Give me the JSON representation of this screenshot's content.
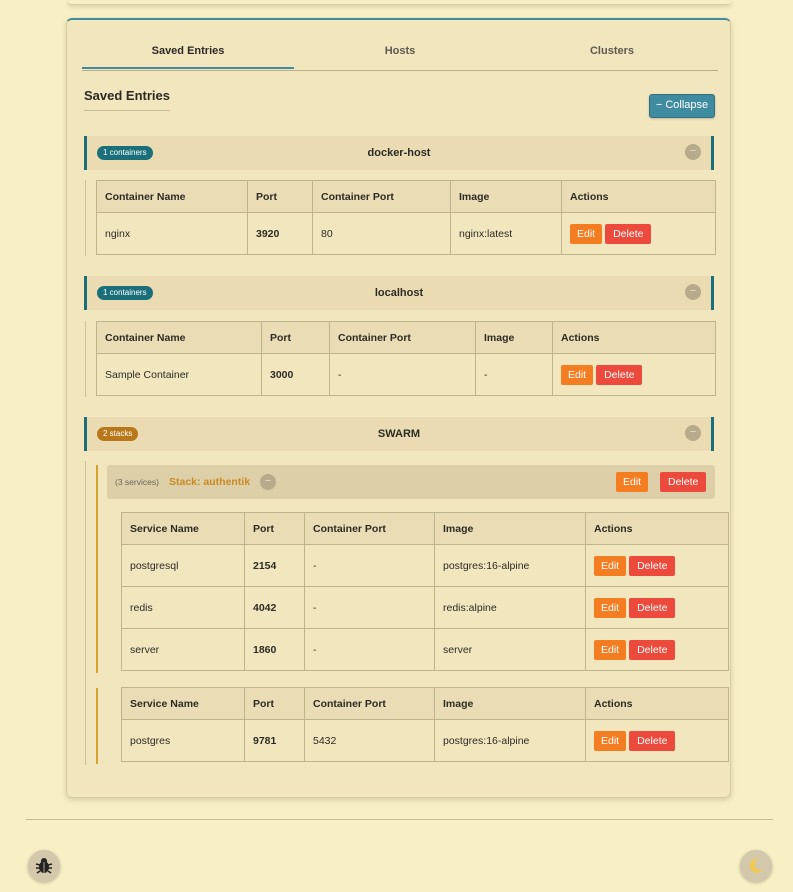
{
  "tabs": [
    "Saved Entries",
    "Hosts",
    "Clusters"
  ],
  "section_title": "Saved Entries",
  "collapse_label": "− Collapse",
  "toggle_symbol": "−",
  "hosts": [
    {
      "badge": "1 containers",
      "name": "docker-host",
      "headers": [
        "Container Name",
        "Port",
        "Container Port",
        "Image",
        "Actions"
      ],
      "rows": [
        [
          "nginx",
          "3920",
          "80",
          "nginx:latest"
        ]
      ]
    },
    {
      "badge": "1 containers",
      "name": "localhost",
      "headers": [
        "Container Name",
        "Port",
        "Container Port",
        "Image",
        "Actions"
      ],
      "rows": [
        [
          "Sample Container",
          "3000",
          "-",
          "-"
        ]
      ]
    }
  ],
  "swarm": {
    "badge": "2 stacks",
    "name": "SWARM",
    "stack": {
      "services_label": "(3 services)",
      "name": "Stack: authentik"
    },
    "table1": {
      "headers": [
        "Service Name",
        "Port",
        "Container Port",
        "Image",
        "Actions"
      ],
      "rows": [
        [
          "postgresql",
          "2154",
          "-",
          "postgres:16-alpine"
        ],
        [
          "redis",
          "4042",
          "-",
          "redis:alpine"
        ],
        [
          "server",
          "1860",
          "-",
          "server"
        ]
      ]
    },
    "table2": {
      "headers": [
        "Service Name",
        "Port",
        "Container Port",
        "Image",
        "Actions"
      ],
      "rows": [
        [
          "postgres",
          "9781",
          "5432",
          "postgres:16-alpine"
        ]
      ]
    }
  },
  "actions": {
    "edit": "Edit",
    "delete": "Delete"
  },
  "icons": {
    "bug": "bug-icon",
    "theme": "moon-icon"
  },
  "colors": {
    "accent": "#3f8ba0",
    "edit": "#f47d21",
    "delete": "#ec4a3c",
    "stack": "#c98a22"
  }
}
